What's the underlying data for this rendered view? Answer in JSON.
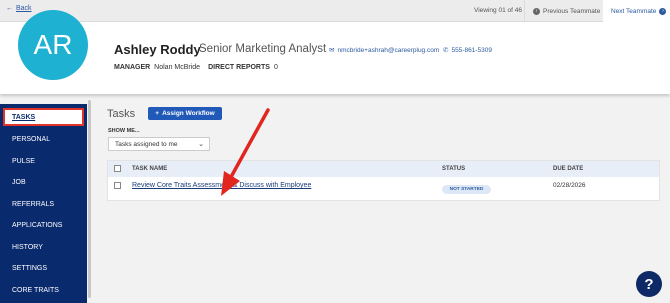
{
  "topbar": {
    "back_label": "Back",
    "viewing": "Viewing 01 of 46",
    "prev_label": "Previous Teammate",
    "next_label": "Next Teammate"
  },
  "profile": {
    "initials": "AR",
    "name": "Ashley Roddy",
    "title": "Senior Marketing Analyst",
    "email": "nmcbride+ashrah@careerplug.com",
    "phone": "555-861-5309",
    "manager_label": "MANAGER",
    "manager": "Nolan McBride",
    "reports_label": "DIRECT REPORTS",
    "reports": "0"
  },
  "sidebar": {
    "items": [
      {
        "label": "TASKS"
      },
      {
        "label": "PERSONAL"
      },
      {
        "label": "PULSE"
      },
      {
        "label": "JOB"
      },
      {
        "label": "REFERRALS"
      },
      {
        "label": "APPLICATIONS"
      },
      {
        "label": "HISTORY"
      },
      {
        "label": "SETTINGS"
      },
      {
        "label": "CORE TRAITS"
      }
    ]
  },
  "main": {
    "title": "Tasks",
    "assign_label": "Assign Workflow",
    "showme_label": "SHOW ME...",
    "filter_value": "Tasks assigned to me",
    "columns": {
      "task": "TASK NAME",
      "status": "STATUS",
      "due": "DUE DATE"
    },
    "rows": [
      {
        "task": "Review Core Traits Assessment & Discuss with Employee",
        "status": "NOT STARTED",
        "due": "02/28/2026"
      }
    ]
  },
  "colors": {
    "accent": "#2059b8",
    "sidebar": "#0a2a6e",
    "highlight": "#e0332a",
    "avatar": "#1fb1d1"
  }
}
